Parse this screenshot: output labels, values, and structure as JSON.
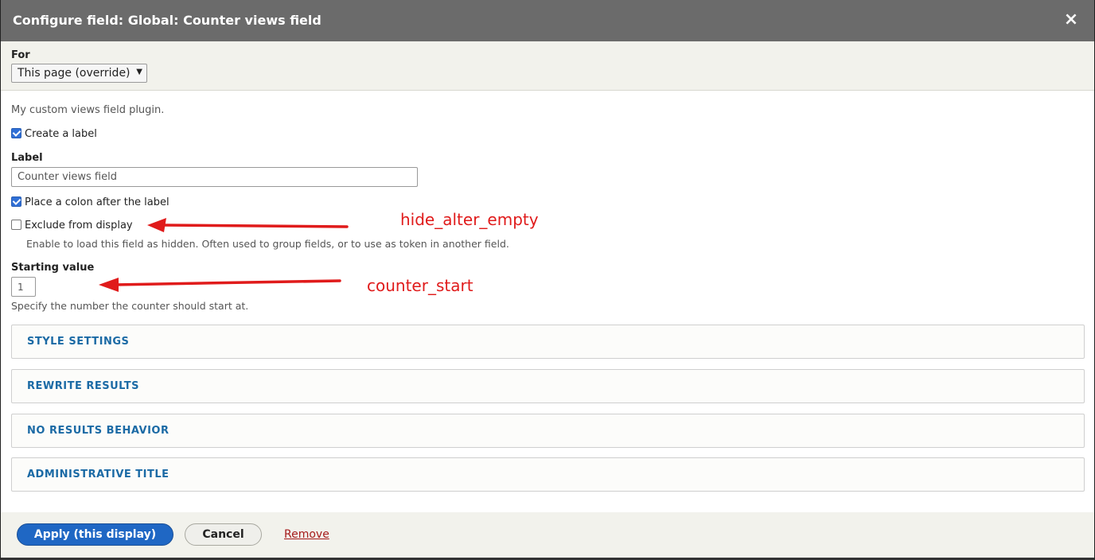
{
  "dialog": {
    "title": "Configure field: Global: Counter views field",
    "close_glyph": "×",
    "close_icon": "close-icon"
  },
  "for_section": {
    "label": "For",
    "selected": "This page (override)",
    "caret_glyph": "▼",
    "caret_icon": "chevron-down-icon"
  },
  "form": {
    "description": "My custom views field plugin.",
    "create_label": {
      "label": "Create a label",
      "checked": true
    },
    "label_field": {
      "heading": "Label",
      "value": "Counter views field"
    },
    "place_colon": {
      "label": "Place a colon after the label",
      "checked": true
    },
    "exclude": {
      "label": "Exclude from display",
      "checked": false,
      "help": "Enable to load this field as hidden. Often used to group fields, or to use as token in another field."
    },
    "starting_value": {
      "heading": "Starting value",
      "value": "1",
      "help": "Specify the number the counter should start at."
    }
  },
  "sections": [
    {
      "label": "STYLE SETTINGS"
    },
    {
      "label": "REWRITE RESULTS"
    },
    {
      "label": "NO RESULTS BEHAVIOR"
    },
    {
      "label": "ADMINISTRATIVE TITLE"
    }
  ],
  "footer": {
    "apply_label": "Apply (this display)",
    "cancel_label": "Cancel",
    "remove_label": "Remove"
  },
  "annotations": {
    "color": "#e01b1b",
    "exclude_note": "hide_alter_empty",
    "starting_note": "counter_start"
  },
  "colors": {
    "titlebar": "#6b6b6b",
    "primary_button": "#1f67c4",
    "section_link": "#1b6aa5",
    "remove_link": "#a51b1b"
  }
}
